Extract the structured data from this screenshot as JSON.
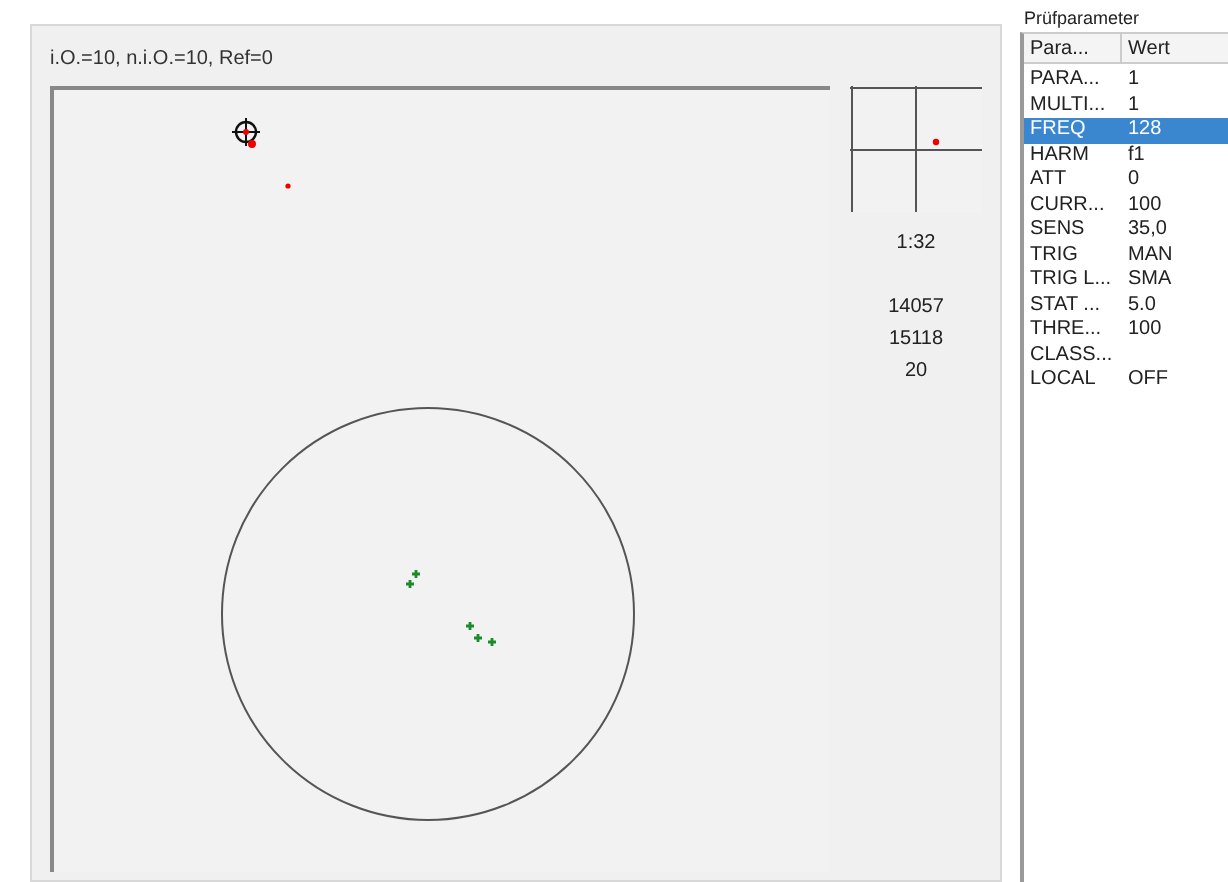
{
  "plot_panel": {
    "title": "i.O.=10, n.i.O.=10, Ref=0"
  },
  "side_info": {
    "time": "1:32",
    "values": [
      "14057",
      "15118",
      "20"
    ]
  },
  "params": {
    "title": "Prüfparameter",
    "columns": [
      "Para...",
      "Wert"
    ],
    "rows": [
      {
        "name": "PARA...",
        "value": "1",
        "selected": false
      },
      {
        "name": "MULTI...",
        "value": "1",
        "selected": false
      },
      {
        "name": "FREQ",
        "value": "128",
        "selected": true
      },
      {
        "name": "HARM",
        "value": "f1",
        "selected": false
      },
      {
        "name": "ATT",
        "value": "0",
        "selected": false
      },
      {
        "name": "CURR...",
        "value": "100",
        "selected": false
      },
      {
        "name": "SENS",
        "value": "35,0",
        "selected": false
      },
      {
        "name": "TRIG",
        "value": "MAN",
        "selected": false
      },
      {
        "name": "TRIG L...",
        "value": "SMA",
        "selected": false
      },
      {
        "name": "STAT ...",
        "value": "5.0",
        "selected": false
      },
      {
        "name": "THRE...",
        "value": "100",
        "selected": false
      },
      {
        "name": "CLASS...",
        "selected": false
      },
      {
        "name": "LOCAL",
        "value": "OFF",
        "selected": false
      }
    ]
  }
}
